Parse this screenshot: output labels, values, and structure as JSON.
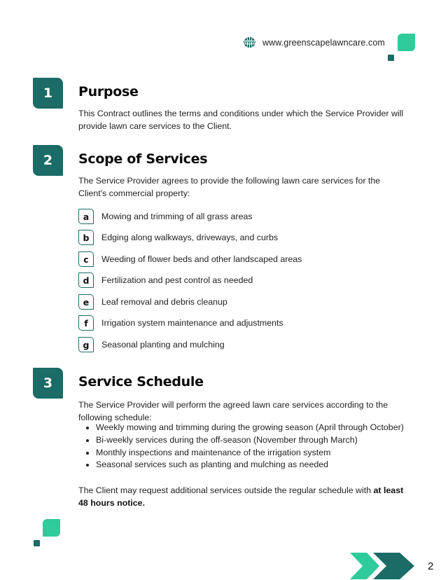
{
  "header": {
    "website_icon": "www-globe-icon",
    "website": "www.greenscapelawncare.com"
  },
  "colors": {
    "primary_dark": "#1b6b66",
    "accent_green": "#2ecc9a"
  },
  "sections": [
    {
      "number": "1",
      "title": "Purpose",
      "paragraph": "This Contract outlines the terms and conditions under which the Service Provider will provide lawn care services to the Client."
    },
    {
      "number": "2",
      "title": "Scope of Services",
      "paragraph": "The Service Provider agrees to provide the following lawn care services for the Client's commercial property:",
      "items": [
        {
          "letter": "a",
          "text": "Mowing and trimming of all grass areas"
        },
        {
          "letter": "b",
          "text": "Edging along walkways, driveways, and curbs"
        },
        {
          "letter": "c",
          "text": "Weeding of flower beds and other landscaped areas"
        },
        {
          "letter": "d",
          "text": "Fertilization and pest control as needed"
        },
        {
          "letter": "e",
          "text": "Leaf removal and debris cleanup"
        },
        {
          "letter": "f",
          "text": "Irrigation system maintenance and adjustments"
        },
        {
          "letter": "g",
          "text": "Seasonal planting and mulching"
        }
      ]
    },
    {
      "number": "3",
      "title": "Service Schedule",
      "paragraph": "The Service Provider will perform the agreed lawn care services according to the following schedule:",
      "bullets": [
        "Weekly mowing and trimming during the growing season (April through October)",
        "Bi-weekly services during the off-season (November through March)",
        "Monthly inspections and maintenance of the irrigation system",
        "Seasonal services such as planting and mulching as needed"
      ],
      "closing_text": "The Client may request additional services outside the regular schedule with ",
      "closing_bold": "at least 48 hours notice."
    }
  ],
  "footer": {
    "page_number": "2",
    "decoration_icon": "double-chevron-right-icon"
  }
}
